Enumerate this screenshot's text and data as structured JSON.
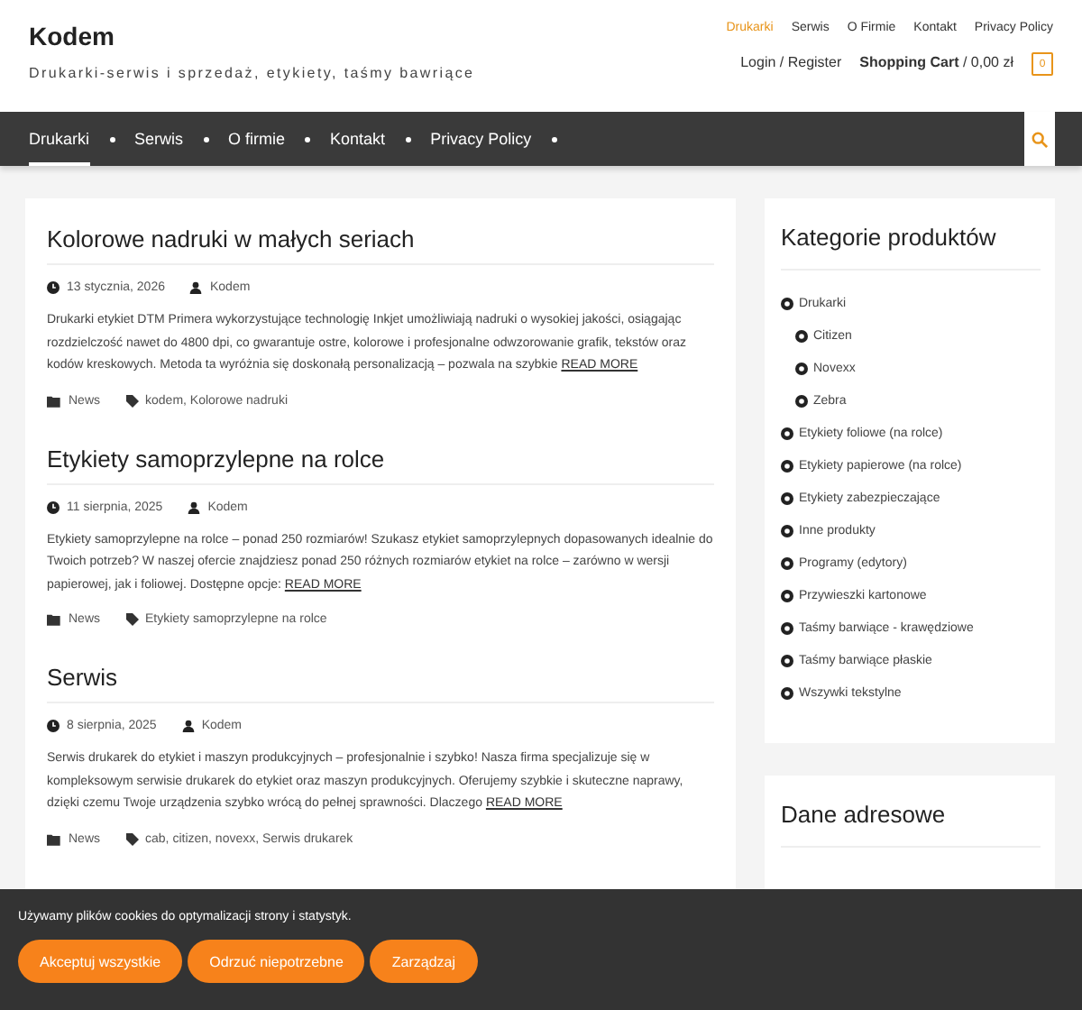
{
  "site": {
    "title": "Kodem",
    "tagline": "Drukarki-serwis i sprzedaż, etykiety, taśmy bawriące"
  },
  "top_menu": [
    {
      "label": "Drukarki",
      "selected": true
    },
    {
      "label": "Serwis",
      "selected": false
    },
    {
      "label": "O Firmie",
      "selected": false
    },
    {
      "label": "Kontakt",
      "selected": false
    },
    {
      "label": "Privacy Policy",
      "selected": false
    }
  ],
  "account": {
    "login": "Login / Register",
    "cart_label": "Shopping Cart",
    "cart_total": "/ 0,00 zł",
    "cart_count": "0"
  },
  "nav": [
    {
      "label": "Drukarki",
      "selected": true
    },
    {
      "label": "Serwis",
      "selected": false
    },
    {
      "label": "O firmie",
      "selected": false
    },
    {
      "label": "Kontakt",
      "selected": false
    },
    {
      "label": "Privacy Policy",
      "selected": false
    }
  ],
  "posts": [
    {
      "title": "Kolorowe nadruki w małych seriach",
      "date": "13 stycznia, 2026",
      "author": "Kodem",
      "excerpt": "Drukarki etykiet DTM Primera wykorzystujące technologię Inkjet umożliwiają nadruki o wysokiej jakości, osiągając rozdzielczość nawet do 4800 dpi, co gwarantuje ostre, kolorowe i profesjonalne odwzorowanie grafik, tekstów oraz kodów kreskowych. Metoda ta wyróżnia się doskonałą personalizacją – pozwala na szybkie",
      "more": "READ MORE",
      "category": "News",
      "tags": "kodem, Kolorowe nadruki"
    },
    {
      "title": "Etykiety samoprzylepne na rolce",
      "date": "11 sierpnia, 2025",
      "author": "Kodem",
      "excerpt": "Etykiety samoprzylepne na rolce – ponad 250 rozmiarów! Szukasz etykiet samoprzylepnych dopasowanych idealnie do Twoich potrzeb? W naszej ofercie znajdziesz ponad 250 różnych rozmiarów etykiet na rolce – zarówno w wersji papierowej, jak i foliowej. Dostępne opcje:",
      "more": "READ MORE",
      "category": "News",
      "tags": "Etykiety samoprzylepne na rolce"
    },
    {
      "title": "Serwis",
      "date": "8 sierpnia, 2025",
      "author": "Kodem",
      "excerpt": "Serwis drukarek do etykiet i maszyn produkcyjnych – profesjonalnie i szybko! Nasza firma specjalizuje się w kompleksowym serwisie drukarek do etykiet oraz maszyn produkcyjnych. Oferujemy szybkie i skuteczne naprawy, dzięki czemu Twoje urządzenia szybko wrócą do pełnej sprawności. Dlaczego",
      "more": "READ MORE",
      "category": "News",
      "tags": "cab, citizen, novexx, Serwis drukarek"
    }
  ],
  "sidebar": {
    "categories_title": "Kategorie produktów",
    "categories": [
      {
        "label": "Drukarki",
        "children": [
          {
            "label": "Citizen"
          },
          {
            "label": "Novexx"
          },
          {
            "label": "Zebra"
          }
        ]
      },
      {
        "label": "Etykiety foliowe (na rolce)"
      },
      {
        "label": "Etykiety papierowe (na rolce)"
      },
      {
        "label": "Etykiety zabezpieczające"
      },
      {
        "label": "Inne produkty"
      },
      {
        "label": "Programy (edytory)"
      },
      {
        "label": "Przywieszki kartonowe"
      },
      {
        "label": "Taśmy barwiące - krawędziowe"
      },
      {
        "label": "Taśmy barwiące płaskie"
      },
      {
        "label": "Wszywki tekstylne"
      }
    ],
    "address_title": "Dane adresowe"
  },
  "cookie_bar": {
    "message": "Używamy plików cookies do optymalizacji strony i statystyk.",
    "buttons": [
      "Akceptuj wszystkie",
      "Odrzuć niepotrzebne",
      "Zarządzaj"
    ]
  }
}
